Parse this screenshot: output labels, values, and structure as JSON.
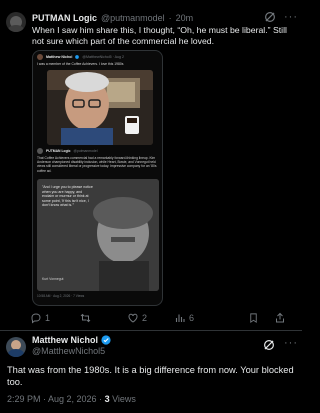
{
  "tweet": {
    "display_name": "PUTMAN Logic",
    "handle": "@putmanmodel",
    "separator": "·",
    "time": "20m",
    "text": "When I saw him share this, I thought, “Oh, he must be liberal.” Still not sure which part of the commercial he loved.",
    "quote": {
      "author": "Matthew Nichol",
      "verified": true,
      "handle": "@MatthewNichol5 · Aug 2",
      "text": "I was a member of the Coffee Achievers. I love this 1980s",
      "sub_author": "PUTMAN Logic",
      "sub_handle": "@putmanmodel",
      "sub_text": "That Coffee Achievers commercial had a remarkably forward-thinking lineup. Kim Anderson championed disability inclusion, while Heart, Bowie, and Vonnegut held views still considered liberal or progressive today. Impressive company for an '80s coffee ad.",
      "quote_image_text": "\"And I urge you to please notice when you are happy, and exclaim or murmur or think at some point, 'If this isn't nice, I don't know what is.'\"",
      "quote_image_author": "Kurt Vonnegut",
      "footer": "10:58 AM · Aug 2, 2026 · 7 Views"
    },
    "actions": {
      "reply_count": "1",
      "retweet_count": "",
      "like_count": "2",
      "views_count": "6"
    }
  },
  "reply": {
    "display_name": "Matthew Nichol",
    "verified": true,
    "handle": "@MatthewNichol5",
    "text": "That was from the 1980s. It is a big difference from now. Your blocked too.",
    "time": "2:29 PM · Aug 2, 2026 · ",
    "views_count": "3",
    "views_label": " Views"
  },
  "colors": {
    "background": "#000000",
    "text": "#e7e9ea",
    "muted": "#71767b",
    "verified": "#1d9bf0",
    "divider": "#2f3336"
  },
  "icons": [
    "grok-icon",
    "more-icon",
    "reply-icon",
    "retweet-icon",
    "like-icon",
    "views-icon",
    "bookmark-icon",
    "share-icon",
    "verified-badge-icon"
  ]
}
